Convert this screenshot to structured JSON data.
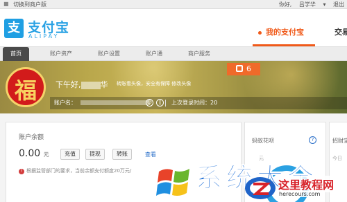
{
  "topbar": {
    "switch_label": "切换到商户版",
    "greeting": "你好,",
    "user_name": "吕学华",
    "logout": "退出"
  },
  "header": {
    "logo_glyph": "支",
    "logo_cn": "支付宝",
    "logo_en": "ALIPAY",
    "nav_mine": "我的支付宝",
    "nav_trade": "交易",
    "accent_color": "#f05a1a",
    "brand_color": "#1f9fe3"
  },
  "tabs": [
    {
      "label": "首页",
      "active": true
    },
    {
      "label": "账户资产"
    },
    {
      "label": "账户设置"
    },
    {
      "label": "账户通"
    },
    {
      "label": "商户服务"
    }
  ],
  "profile": {
    "avatar_glyph": "福",
    "greeting": "下午好,",
    "name_suffix": "华",
    "links": "转账看头像，安全有保障 修改头像",
    "badge_count": "6",
    "account_label": "账户名：",
    "last_login_label": "上次登录时间：20"
  },
  "balance": {
    "title": "账户余额",
    "amount": "0.00",
    "unit": "元",
    "btn_recharge": "充值",
    "btn_withdraw": "提现",
    "btn_transfer": "转账",
    "view": "查看",
    "notice": "根据监管部门的要求，当前余额支付额度20万元/"
  },
  "huabei": {
    "title": "蚂蚁花呗",
    "help": "?",
    "sub": "元"
  },
  "right_panel": {
    "title": "招财宝",
    "sub": "今日"
  },
  "watermark": {
    "big_text": "系统大全",
    "site_name": "这里教程网",
    "site_url": "herecours.com"
  }
}
